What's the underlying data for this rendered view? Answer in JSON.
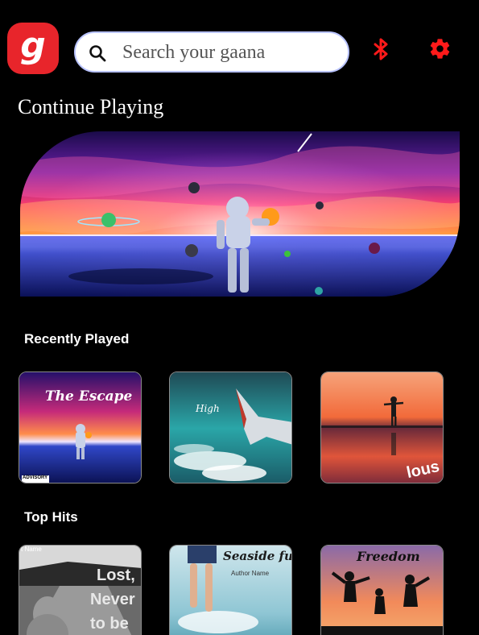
{
  "header": {
    "logo_letter": "g",
    "search_placeholder": "Search your gaana",
    "icons": [
      "search-icon",
      "bluetooth-icon",
      "settings-gear-icon"
    ],
    "accent_color": "#e8252b"
  },
  "continue_playing": {
    "title": "Continue Playing"
  },
  "recently_played": {
    "title": "Recently Played",
    "items": [
      {
        "cover_text": "The Escape",
        "badge": "ADVISORY"
      },
      {
        "cover_text": "High"
      },
      {
        "cover_text": "lous"
      }
    ]
  },
  "top_hits": {
    "title": "Top Hits",
    "items": [
      {
        "cover_lines": [
          "Lost,",
          "Never",
          "to be"
        ],
        "corner_text": "t Name"
      },
      {
        "cover_text": "Seaside fun",
        "sub_text": "Author Name"
      },
      {
        "cover_text": "Freedom"
      }
    ]
  }
}
